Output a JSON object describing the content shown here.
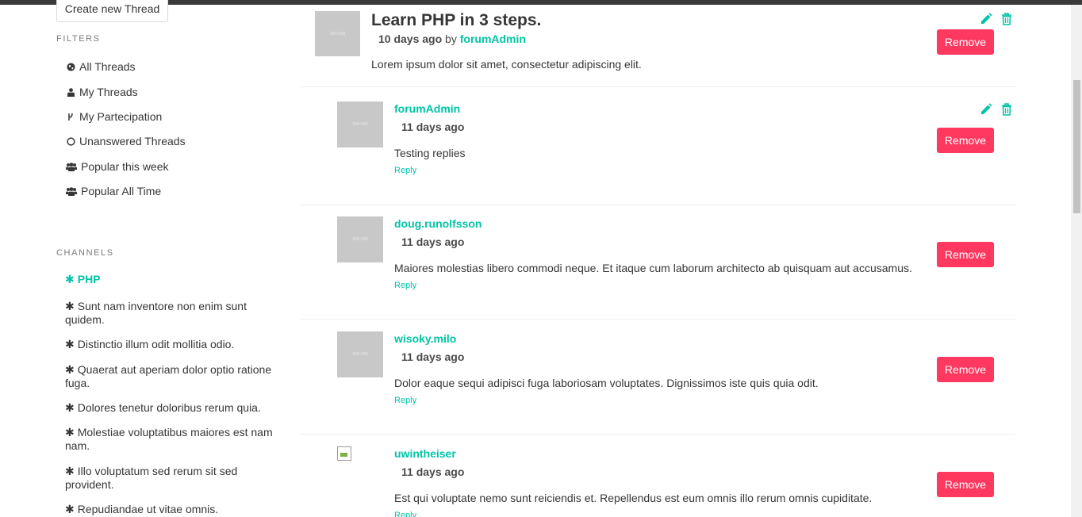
{
  "sidebar": {
    "create_thread_label": "Create new Thread",
    "filters_heading": "FILTERS",
    "filters": [
      {
        "label": "All Threads",
        "icon": "globe-icon"
      },
      {
        "label": "My Threads",
        "icon": "user-icon"
      },
      {
        "label": "My Partecipation",
        "icon": "code-fork-icon"
      },
      {
        "label": "Unanswered Threads",
        "icon": "circle-icon"
      },
      {
        "label": "Popular this week",
        "icon": "users-icon"
      },
      {
        "label": "Popular All Time",
        "icon": "users-icon"
      }
    ],
    "channels_heading": "CHANNELS",
    "channels": [
      {
        "label": "PHP",
        "active": true
      },
      {
        "label": "Sunt nam inventore non enim sunt quidem.",
        "active": false
      },
      {
        "label": "Distinctio illum odit mollitia odio.",
        "active": false
      },
      {
        "label": "Quaerat aut aperiam dolor optio ratione fuga.",
        "active": false
      },
      {
        "label": "Dolores tenetur doloribus rerum quia.",
        "active": false
      },
      {
        "label": "Molestiae voluptatibus maiores est nam nam.",
        "active": false
      },
      {
        "label": "Illo voluptatum sed rerum sit sed provident.",
        "active": false
      },
      {
        "label": "Repudiandae ut vitae omnis.",
        "active": false
      }
    ]
  },
  "thread": {
    "title": "Learn PHP in 3 steps.",
    "time": "10 days ago",
    "by": "by",
    "author": "forumAdmin",
    "body": "Lorem ipsum dolor sit amet, consectetur adipiscing elit.",
    "remove_label": "Remove",
    "avatar_text": "256×256"
  },
  "replies": [
    {
      "user": "forumAdmin",
      "time": "11 days ago",
      "body": "Testing replies",
      "reply_label": "Reply",
      "remove_label": "Remove",
      "editable": true
    },
    {
      "user": "doug.runolfsson",
      "time": "11 days ago",
      "body": "Maiores molestias libero commodi neque. Et itaque cum laborum architecto ab quisquam aut accusamus.",
      "reply_label": "Reply",
      "remove_label": "Remove",
      "editable": false
    },
    {
      "user": "wisoky.milo",
      "time": "11 days ago",
      "body": "Dolor eaque sequi adipisci fuga laboriosam voluptates. Dignissimos iste quis quia odit.",
      "reply_label": "Reply",
      "remove_label": "Remove",
      "editable": false
    },
    {
      "user": "uwintheiser",
      "time": "11 days ago",
      "body": "Est qui voluptate nemo sunt reiciendis et. Repellendus est eum omnis illo rerum omnis cupiditate.",
      "reply_label": "Reply",
      "remove_label": "Remove",
      "editable": false
    }
  ],
  "colors": {
    "accent": "#00c4a7",
    "danger": "#ff3860",
    "text": "#363636"
  }
}
